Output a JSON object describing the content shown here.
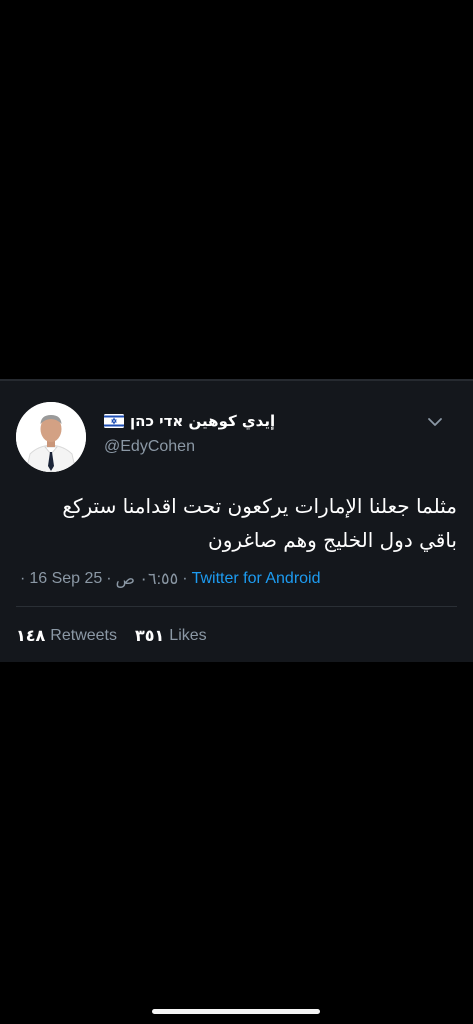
{
  "tweet": {
    "display_name": "إيدي كوهين אדי כהן",
    "handle": "@EdyCohen",
    "body_line1": "مثلما جعلنا الإمارات يركعون تحت اقدامنا ستركع",
    "body_line2": "باقي دول الخليج وهم صاغرون",
    "date": "16 Sep 25",
    "time": "٠٦:٥٥ ص",
    "meta_separator": "·",
    "source": "Twitter for Android",
    "retweets_count": "١٤٨",
    "retweets_label": "Retweets",
    "likes_count": "٣٥١",
    "likes_label": "Likes"
  },
  "icons": {
    "flag": "israel-flag-icon",
    "menu": "chevron-down-icon"
  },
  "colors": {
    "background": "#000000",
    "card": "#14171c",
    "secondary_text": "#8b98a5",
    "link": "#1d9bf0"
  }
}
